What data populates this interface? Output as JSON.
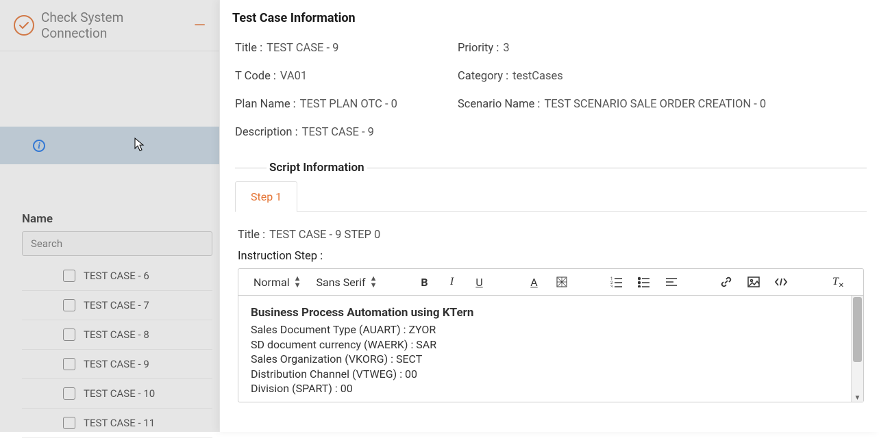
{
  "leftHeader": {
    "label": "Check System Connection"
  },
  "nameSection": {
    "label": "Name",
    "searchPlaceholder": "Search"
  },
  "testList": [
    {
      "label": "TEST CASE - 6"
    },
    {
      "label": "TEST CASE - 7"
    },
    {
      "label": "TEST CASE - 8"
    },
    {
      "label": "TEST CASE - 9"
    },
    {
      "label": "TEST CASE - 10"
    },
    {
      "label": "TEST CASE - 11"
    }
  ],
  "testCaseInfo": {
    "heading": "Test Case Information",
    "titleLabel": "Title :",
    "titleValue": "TEST CASE - 9",
    "priorityLabel": "Priority :",
    "priorityValue": "3",
    "tCodeLabel": "T Code :",
    "tCodeValue": "VA01",
    "categoryLabel": "Category :",
    "categoryValue": "testCases",
    "planNameLabel": "Plan Name :",
    "planNameValue": "TEST PLAN OTC - 0",
    "scenarioLabel": "Scenario Name :",
    "scenarioValue": "TEST SCENARIO SALE ORDER CREATION - 0",
    "descLabel": "Description :",
    "descValue": "TEST CASE - 9"
  },
  "script": {
    "sectionLabel": "Script Information",
    "tab1": "Step 1",
    "stepTitleLabel": "Title :",
    "stepTitleValue": "TEST CASE - 9 STEP 0",
    "instructionLabel": "Instruction Step :"
  },
  "toolbar": {
    "format": "Normal",
    "font": "Sans Serif"
  },
  "editor": {
    "headline": "Business Process Automation using KTern",
    "lines": [
      "Sales Document Type (AUART) : ZYOR",
      "SD document currency (WAERK) : SAR",
      "Sales Organization (VKORG) : SECT",
      "Distribution Channel (VTWEG) : 00",
      "Division (SPART) : 00"
    ]
  }
}
